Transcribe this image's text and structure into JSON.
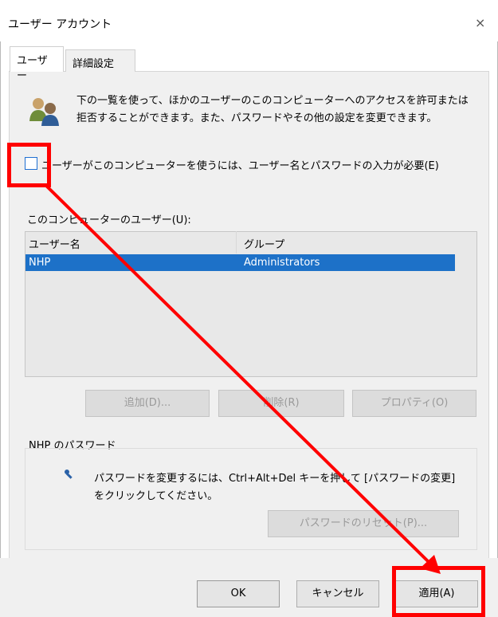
{
  "window": {
    "title": "ユーザー アカウント",
    "close_icon": "×"
  },
  "tabs": [
    {
      "label": "ユーザー",
      "active": true
    },
    {
      "label": "詳細設定",
      "active": false
    }
  ],
  "description": "下の一覧を使って、ほかのユーザーのこのコンピューターへのアクセスを許可または拒否することができます。また、パスワードやその他の設定を変更できます。",
  "require_password": {
    "label": "ユーザーがこのコンピューターを使うには、ユーザー名とパスワードの入力が必要(E)",
    "checked": false
  },
  "users_list": {
    "label": "このコンピューターのユーザー(U):",
    "columns": [
      "ユーザー名",
      "グループ"
    ],
    "rows": [
      {
        "user": "NHP",
        "group": "Administrators",
        "selected": true
      }
    ]
  },
  "user_buttons": {
    "add": "追加(D)...",
    "remove": "削除(R)",
    "properties": "プロパティ(O)"
  },
  "password_section": {
    "title": "NHP のパスワード",
    "text": "パスワードを変更するには、Ctrl+Alt+Del キーを押して [パスワードの変更] をクリックしてください。",
    "reset_button": "パスワードのリセット(P)..."
  },
  "dialog_buttons": {
    "ok": "OK",
    "cancel": "キャンセル",
    "apply": "適用(A)"
  },
  "annotation": {
    "color": "#ff0000"
  }
}
